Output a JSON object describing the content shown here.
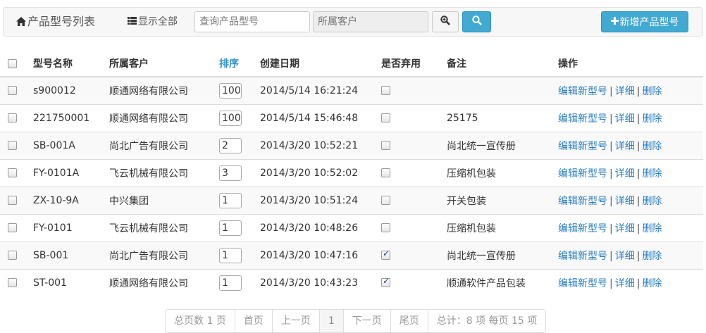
{
  "toolbar": {
    "title": "产品型号列表",
    "title_icon": "home-icon",
    "show_all": "显示全部",
    "show_all_icon": "list-icon",
    "model_placeholder": "查询产品型号",
    "customer_placeholder": "所属客户",
    "zoom_icon": "zoom-in-icon",
    "search_icon": "search-icon",
    "add_label": "新增产品型号",
    "add_icon": "plus-icon"
  },
  "table": {
    "headers": {
      "model": "型号名称",
      "customer": "所属客户",
      "sort": "排序",
      "created": "创建日期",
      "discarded": "是否弃用",
      "note": "备注",
      "actions": "操作"
    },
    "rows": [
      {
        "model": "s900012",
        "customer": "顺通网络有限公司",
        "sort": "100",
        "created": "2014/5/14 16:21:24",
        "discarded": false,
        "note": ""
      },
      {
        "model": "221750001",
        "customer": "顺通网络有限公司",
        "sort": "100",
        "created": "2014/5/14 15:46:48",
        "discarded": false,
        "note": "25175"
      },
      {
        "model": "SB-001A",
        "customer": "尚北广告有限公司",
        "sort": "2",
        "created": "2014/3/20 10:52:21",
        "discarded": false,
        "note": "尚北统一宣传册"
      },
      {
        "model": "FY-0101A",
        "customer": "飞云机械有限公司",
        "sort": "3",
        "created": "2014/3/20 10:52:02",
        "discarded": false,
        "note": "压缩机包装"
      },
      {
        "model": "ZX-10-9A",
        "customer": "中兴集团",
        "sort": "1",
        "created": "2014/3/20 10:51:24",
        "discarded": false,
        "note": "开关包装"
      },
      {
        "model": "FY-0101",
        "customer": "飞云机械有限公司",
        "sort": "1",
        "created": "2014/3/20 10:48:26",
        "discarded": false,
        "note": "压缩机包装"
      },
      {
        "model": "SB-001",
        "customer": "尚北广告有限公司",
        "sort": "1",
        "created": "2014/3/20 10:47:16",
        "discarded": true,
        "note": "尚北统一宣传册"
      },
      {
        "model": "ST-001",
        "customer": "顺通网络有限公司",
        "sort": "1",
        "created": "2014/3/20 10:43:23",
        "discarded": true,
        "note": "顺通软件产品包装"
      }
    ],
    "actions": {
      "edit": "编辑新型号",
      "detail": "详细",
      "delete": "删除",
      "separator": "|"
    }
  },
  "pager": {
    "total_pages": "总页数 1 页",
    "first": "首页",
    "prev": "上一页",
    "current": "1",
    "next": "下一页",
    "last": "尾页",
    "summary": "总计：8 项 每页 15 项"
  },
  "colors": {
    "accent": "#41a9d2",
    "link": "#2a7ec4",
    "sort_header": "#2f8fc9"
  }
}
